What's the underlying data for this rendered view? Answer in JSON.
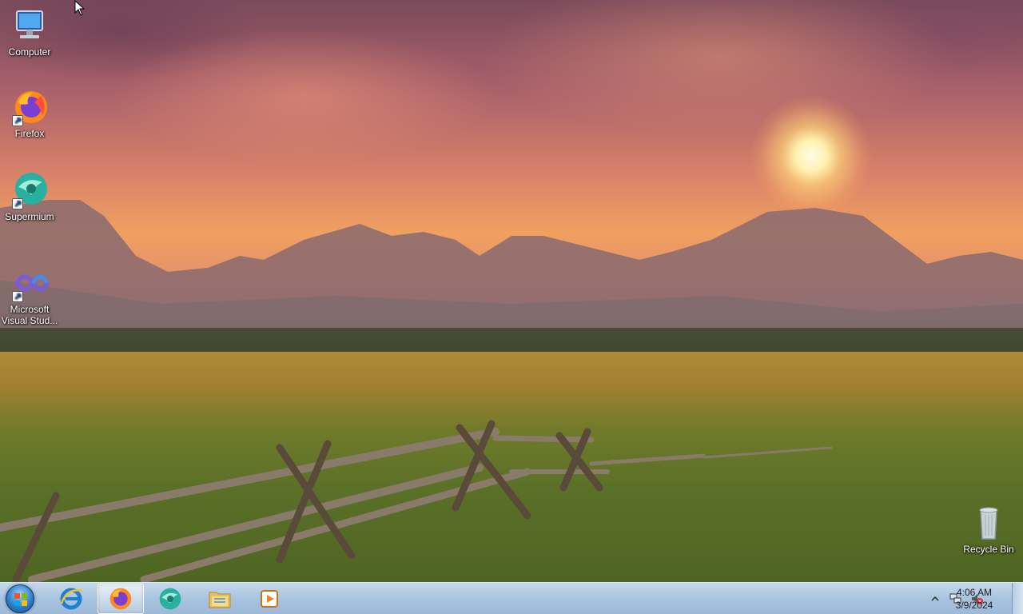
{
  "desktop": {
    "icons": [
      {
        "label": "Computer",
        "icon": "computer-icon"
      },
      {
        "label": "Firefox",
        "icon": "firefox-icon"
      },
      {
        "label": "Supermium",
        "icon": "supermium-icon"
      },
      {
        "label": "Microsoft\nVisual Stud...",
        "label_line1": "Microsoft",
        "label_line2": "Visual Stud...",
        "icon": "visual-studio-icon"
      },
      {
        "label": "Recycle Bin",
        "icon": "recycle-bin-icon"
      }
    ]
  },
  "taskbar": {
    "start": {
      "icon": "windows-start-orb-icon"
    },
    "pinned": [
      {
        "name": "Internet Explorer",
        "icon": "internet-explorer-icon",
        "active": false
      },
      {
        "name": "Firefox",
        "icon": "firefox-icon",
        "active": true
      },
      {
        "name": "Supermium",
        "icon": "supermium-icon",
        "active": false
      },
      {
        "name": "File Explorer",
        "icon": "folder-icon",
        "active": false
      },
      {
        "name": "Media Player",
        "icon": "media-player-icon",
        "active": false
      }
    ],
    "tray": {
      "icons": [
        "show-hidden-icons-chevron-icon",
        "network-icon",
        "volume-muted-icon"
      ],
      "time": "4:06 AM",
      "date": "3/9/2024"
    }
  },
  "colors": {
    "taskbar": "#a9c4df",
    "sky": "#f0a060",
    "meadow": "#5a7028"
  }
}
